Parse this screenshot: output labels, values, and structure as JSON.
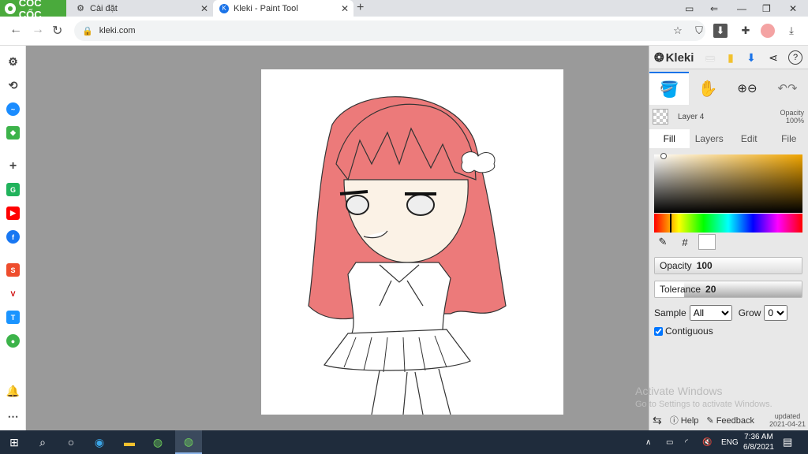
{
  "browser": {
    "logo_text": "CỐC CỐC",
    "tabs": [
      {
        "label": "Cài đặt",
        "icon": "gear-icon"
      },
      {
        "label": "Kleki - Paint Tool",
        "icon": "kleki-icon",
        "active": true
      }
    ],
    "url": "kleki.com"
  },
  "kleki": {
    "brand": "Kleki",
    "layer": {
      "name": "Layer 4",
      "opacity_label": "Opacity",
      "opacity_value": "100%"
    },
    "tabs": [
      "Fill",
      "Layers",
      "Edit",
      "File"
    ],
    "active_tab": "Fill",
    "picker_hash": "#",
    "opacity": {
      "label": "Opacity",
      "value": "100",
      "fraction": 1.0
    },
    "tolerance": {
      "label": "Tolerance",
      "value": "20",
      "fraction": 0.2
    },
    "sample": {
      "label": "Sample",
      "value": "All"
    },
    "grow": {
      "label": "Grow",
      "value": "0"
    },
    "contiguous": {
      "label": "Contiguous",
      "checked": true
    },
    "footer": {
      "help": "Help",
      "feedback": "Feedback",
      "updated": "updated",
      "updated_date": "2021-04-21"
    },
    "colors": {
      "accent": "#f0a500",
      "hair": "#ec7a7a"
    }
  },
  "windows": {
    "watermark_title": "Activate Windows",
    "watermark_sub": "Go to Settings to activate Windows.",
    "lang": "ENG",
    "time": "7:36 AM",
    "date": "6/8/2021"
  }
}
